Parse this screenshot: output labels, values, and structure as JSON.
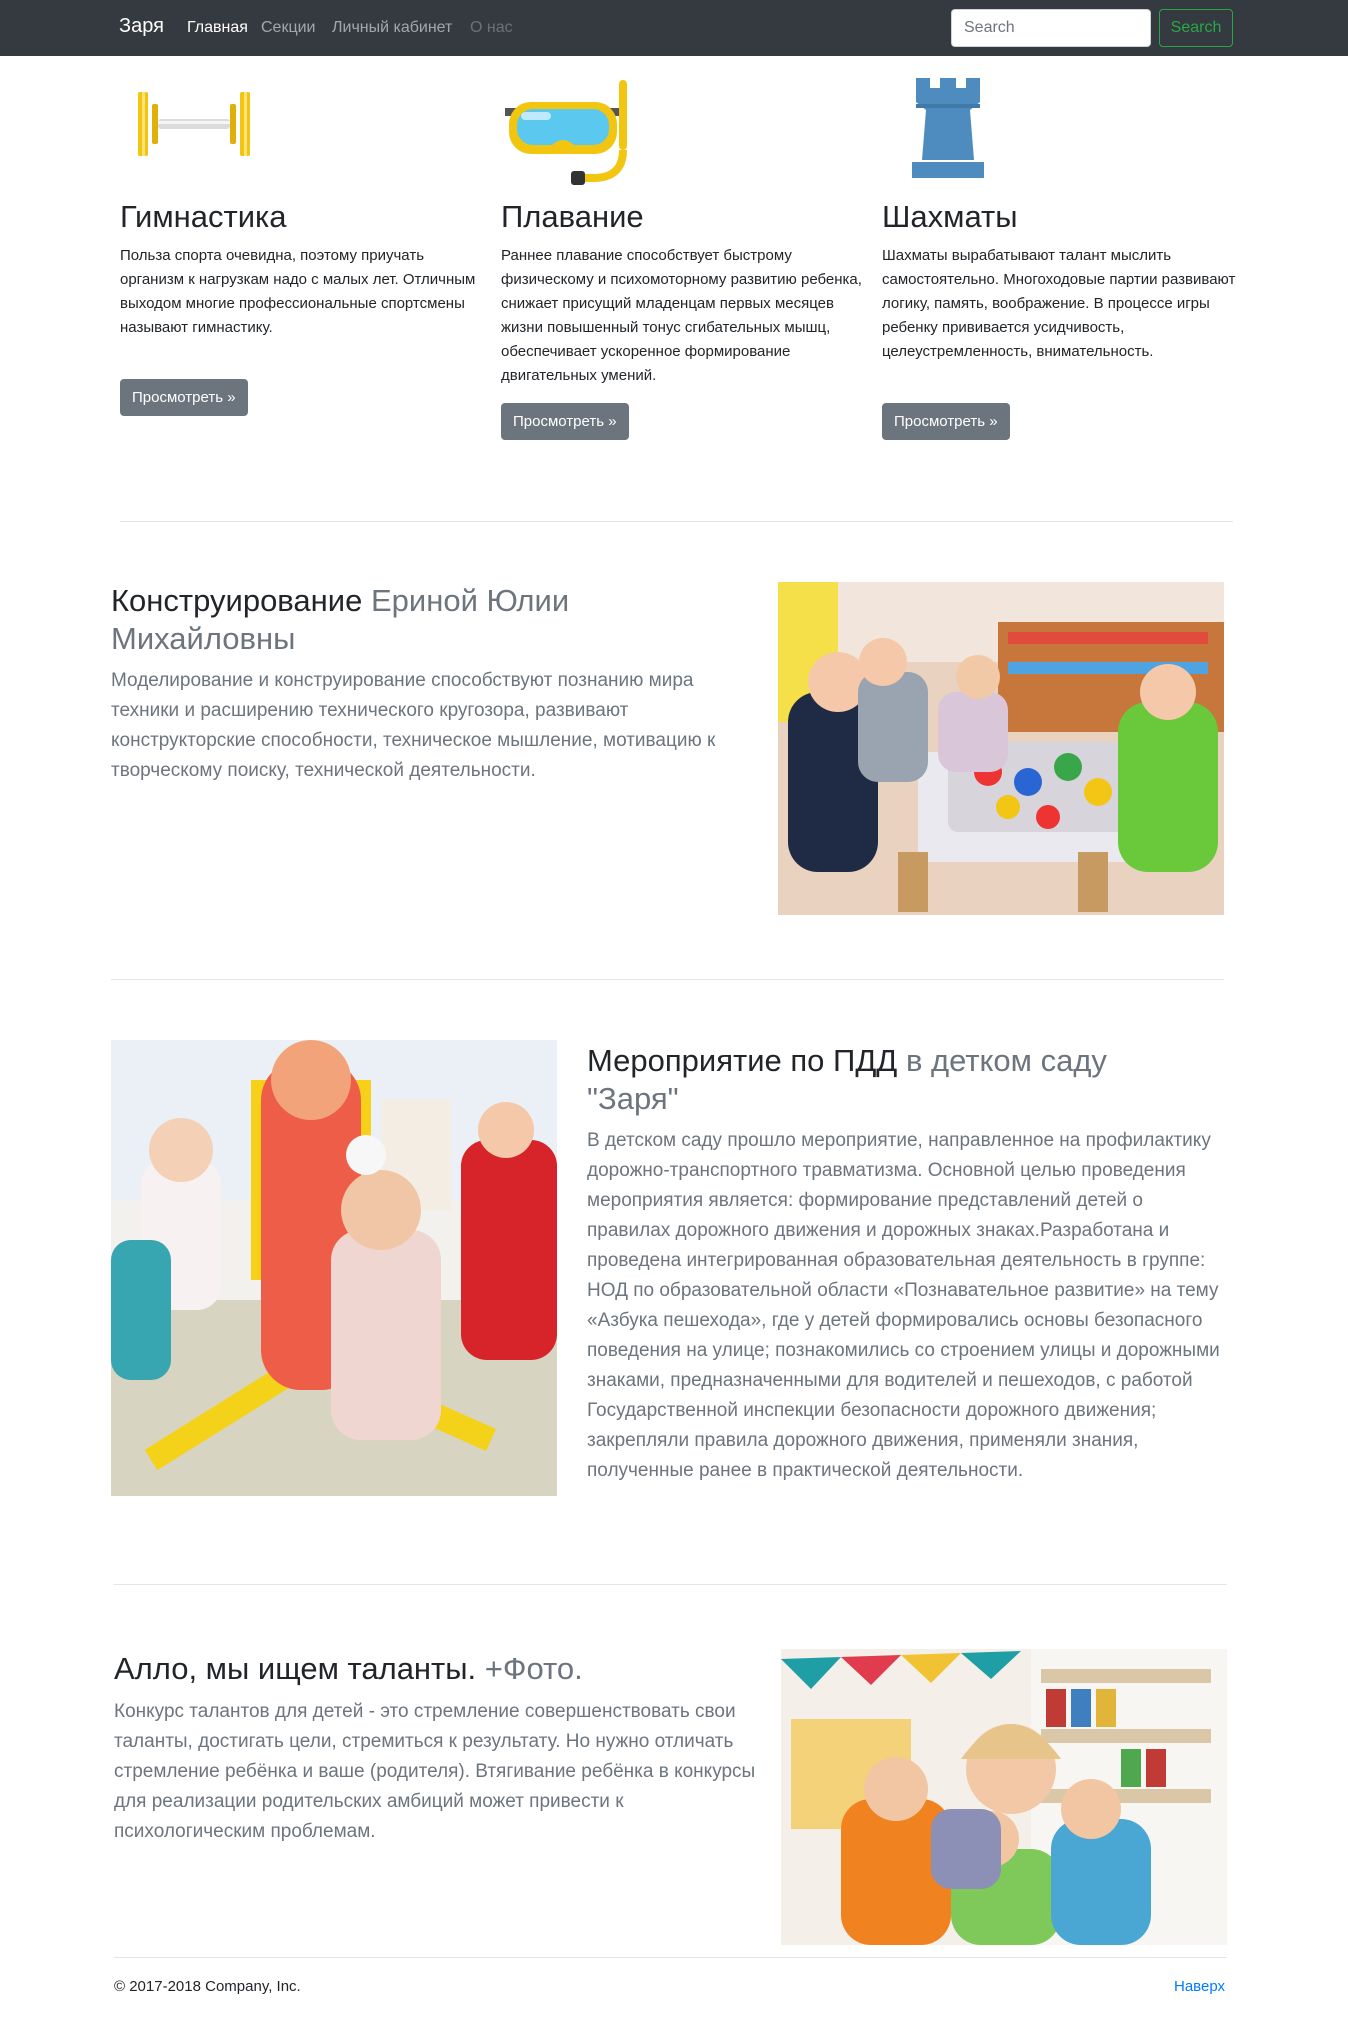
{
  "navbar": {
    "brand": "Заря",
    "links": [
      "Главная",
      "Секции",
      "Личный кабинет",
      "О нас"
    ],
    "search_placeholder": "Search",
    "search_button": "Search"
  },
  "columns": [
    {
      "icon": "dumbbell-icon",
      "title": "Гимнастика",
      "text": "Польза спорта очевидна, поэтому приучать организм к нагрузкам надо с малых лет. Отличным выходом многие профессиональные спортсмены называют гимнастику.",
      "button": "Просмотреть »"
    },
    {
      "icon": "swim-mask-icon",
      "title": "Плавание",
      "text": "Раннее плавание способствует быстрому физическому и психомоторному развитию ребенка, снижает присущий младенцам первых месяцев жизни повышенный тонус сгибательных мышц, обеспечивает ускоренное формирование двигательных умений.",
      "button": "Просмотреть »"
    },
    {
      "icon": "chess-rook-icon",
      "title": "Шахматы",
      "text": "Шахматы вырабатывают талант мыслить самостоятельно. Многоходовые партии развивают логику, память, воображение. В процессе игры ребенку прививается усидчивость, целеустремленность, внимательность.",
      "button": "Просмотреть »"
    }
  ],
  "features": [
    {
      "heading": "Конструирование",
      "heading_muted": "Ериной Юлии Михайловны",
      "text": "Моделирование и конструирование способствуют познанию мира техники и расширению технического кругозора, развивают конструкторские способности, техническое мышление, мотивацию к творческому поиску, технической деятельности.",
      "image": "children-building-blocks-photo"
    },
    {
      "heading": "Мероприятие по ПДД",
      "heading_muted": "в детком саду \"Заря\"",
      "text": "В детском саду прошло мероприятие, направленное на профилактику дорожно-транспортного травматизма. Основной целью проведения мероприятия является: формирование представлений детей о правилах дорожного движения и дорожных знаках.Разработана и проведена интегрированная образовательная деятельность в группе: НОД по образовательной области «Познавательное развитие» на тему «Азбука пешехода», где у детей формировались основы безопасного поведения на улице; познакомились со строением улицы и дорожными знаками, предназначенными для водителей и пешеходов, с работой Государственной инспекции безопасности дорожного движения; закрепляли правила дорожного движения, применяли знания, полученные ранее в практической деятельности.",
      "image": "children-traffic-event-photo"
    },
    {
      "heading": "Алло, мы ищем таланты.",
      "heading_muted": "+Фото.",
      "text": "Конкурс талантов для детей - это стремление совершенствовать свои таланты, достигать цели, стремиться к результату. Но нужно отличать стремление ребёнка и ваше (родителя). Втягивание ребёнка в конкурсы для реализации родительских амбиций может привести к психологическим проблемам.",
      "image": "teacher-hugging-children-photo"
    }
  ],
  "footer": {
    "copyright": "© 2017-2018 Company, Inc.",
    "back_to_top": "Наверх"
  },
  "colors": {
    "navbar_bg": "#343a40",
    "success": "#28a745",
    "secondary": "#6c757d",
    "link": "#007bff"
  }
}
